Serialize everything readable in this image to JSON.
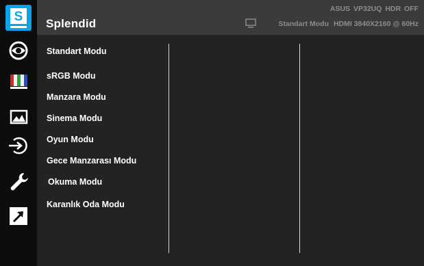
{
  "header": {
    "title": "Splendid",
    "model": "ASUS  VP32UQ  HDR OFF",
    "current_mode": "Standart Modu",
    "signal": "HDMI 3840X2160 @ 60Hz"
  },
  "sidebar": {
    "items": [
      {
        "icon": "splendid-s-icon",
        "selected": true,
        "label": "S"
      },
      {
        "icon": "eye-care-icon"
      },
      {
        "icon": "color-bars-icon"
      },
      {
        "icon": "image-landscape-icon"
      },
      {
        "icon": "input-select-icon"
      },
      {
        "icon": "wrench-system-icon"
      },
      {
        "icon": "shortcut-arrow-icon"
      }
    ]
  },
  "menu": {
    "items": [
      "Standart Modu",
      "sRGB Modu",
      "Manzara  Modu",
      "Sinema Modu",
      "Oyun Modu",
      "Gece Manzarası Modu",
      "Okuma Modu",
      "Karanlık Oda Modu"
    ]
  },
  "colors": {
    "accent": "#0aa3e8",
    "sidebar_bg": "#0d0d0d",
    "main_bg": "#232323",
    "header_bg": "#3b3b3b",
    "text": "#ffffff",
    "header_text": "#8c8c8c"
  }
}
